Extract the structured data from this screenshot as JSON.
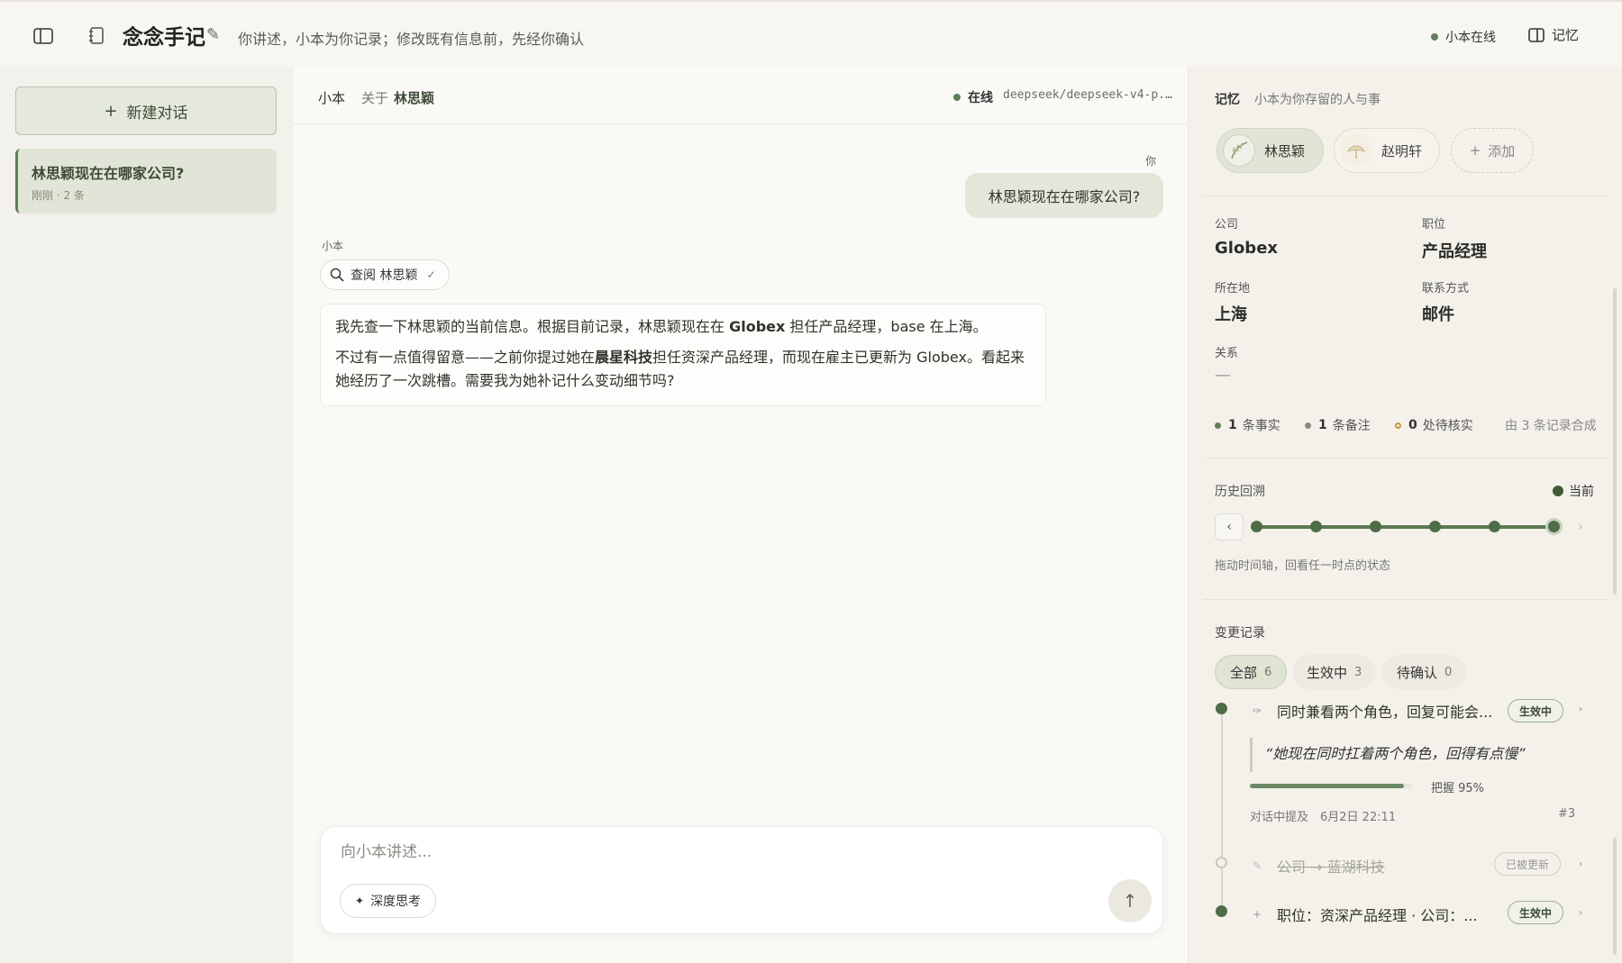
{
  "header": {
    "app_title": "念念手记",
    "title_edit_icon": "pencil-icon",
    "subtitle": "你讲述，小本为你记录；修改既有信息前，先经你确认",
    "status": "小本在线",
    "memory_toggle": "记忆"
  },
  "sidebar": {
    "new_chat": "新建对话",
    "conversations": [
      {
        "title": "林思颖现在在哪家公司?",
        "meta": "刚刚 · 2 条"
      }
    ]
  },
  "chat": {
    "agent": "小本",
    "about_label": "关于",
    "about_name": "林思颖",
    "online": "在线",
    "model": "deepseek/deepseek-v4-p...",
    "you_label": "你",
    "user_message": "林思颖现在在哪家公司?",
    "agent_label": "小本",
    "tool_call": "查阅 林思颖",
    "reply_p1_a": "我先查一下林思颖的当前信息。根据目前记录，林思颖现在在 ",
    "reply_p1_b": "Globex",
    "reply_p1_c": " 担任产品经理，base 在上海。",
    "reply_p2_a": "不过有一点值得留意——之前你提过她在",
    "reply_p2_b": "晨星科技",
    "reply_p2_c": "担任资深产品经理，而现在雇主已更新为 Globex。看起来她经历了一次跳槽。需要我为她补记什么变动细节吗?",
    "composer_placeholder": "向小本讲述...",
    "deep_think": "深度思考"
  },
  "memory": {
    "title": "记忆",
    "subtitle": "小本为你存留的人与事",
    "people": [
      "林思颖",
      "赵明轩"
    ],
    "add": "添加",
    "fields": {
      "company_label": "公司",
      "company": "Globex",
      "role_label": "职位",
      "role": "产品经理",
      "location_label": "所在地",
      "location": "上海",
      "contact_label": "联系方式",
      "contact": "邮件",
      "relation_label": "关系",
      "relation": "—"
    },
    "stats": {
      "facts_n": "1",
      "facts": "条事实",
      "notes_n": "1",
      "notes": "条备注",
      "pending_n": "0",
      "pending": "处待核实",
      "source": "由 3 条记录合成"
    },
    "timeline": {
      "label": "历史回溯",
      "current": "当前",
      "hint": "拖动时间轴，回看任一时点的状态",
      "points": 6,
      "current_index": 5
    },
    "changelog": {
      "label": "变更记录",
      "filters": [
        {
          "label": "全部",
          "count": "6"
        },
        {
          "label": "生效中",
          "count": "3"
        },
        {
          "label": "待确认",
          "count": "0"
        }
      ],
      "entries": [
        {
          "text": "同时兼看两个角色，回复可能会...",
          "status": "生效中",
          "quote": "“她现在同时扛着两个角色，回得有点慢”",
          "confidence_label": "把握 95%",
          "confidence": 0.95,
          "source": "对话中提及　6月2日 22:11",
          "id": "#3"
        },
        {
          "text": "公司 → 蓝湖科技",
          "status": "已被更新"
        },
        {
          "text": "职位：资深产品经理 · 公司：...",
          "status": "生效中"
        }
      ]
    }
  },
  "colors": {
    "accent": "#4f6c48",
    "accent_light": "#e1e5d6",
    "pending": "#c8963e"
  }
}
